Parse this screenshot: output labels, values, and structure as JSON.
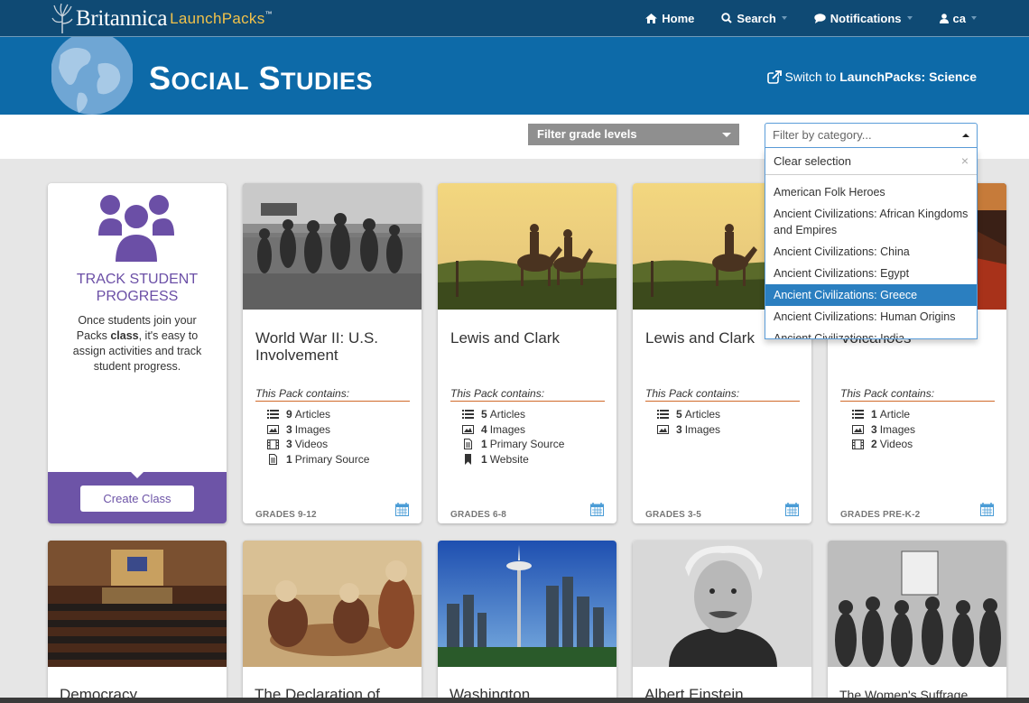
{
  "nav": {
    "logo_brand": "Britannica",
    "logo_product": "LaunchPacks",
    "logo_tm": "™",
    "home": "Home",
    "search": "Search",
    "notifications": "Notifications",
    "user": "ca"
  },
  "banner": {
    "title_first": "S",
    "title_first_rest": "OCIAL",
    "title_second": "S",
    "title_second_rest": "TUDIES",
    "switch_prefix": "Switch to ",
    "switch_target": "LaunchPacks: Science"
  },
  "filters": {
    "grade_placeholder": "Filter grade levels",
    "category_placeholder": "Filter by category..."
  },
  "dropdown": {
    "clear": "Clear selection",
    "options": [
      "American Folk Heroes",
      "Ancient Civilizations: African Kingdoms and Empires",
      "Ancient Civilizations: China",
      "Ancient Civilizations: Egypt",
      "Ancient Civilizations: Greece",
      "Ancient Civilizations: Human Origins",
      "Ancient Civilizations: India"
    ],
    "selected_index": 4
  },
  "track": {
    "title_line1": "TRACK STUDENT",
    "title_line2": "PROGRESS",
    "desc_pre": "Once students join your Packs ",
    "desc_bold": "class",
    "desc_post": ", it's easy to assign activities and track student progress.",
    "button": "Create Class"
  },
  "contains_label": "This Pack contains:",
  "cards": [
    {
      "title": "World War II: U.S. Involvement",
      "items": [
        {
          "icon": "list-icon",
          "count": "9",
          "label": "Articles"
        },
        {
          "icon": "image-icon",
          "count": "3",
          "label": "Images"
        },
        {
          "icon": "film-icon",
          "count": "3",
          "label": "Videos"
        },
        {
          "icon": "document-icon",
          "count": "1",
          "label": "Primary Source"
        }
      ],
      "grades": "GRADES 9-12"
    },
    {
      "title": "Lewis and Clark",
      "items": [
        {
          "icon": "list-icon",
          "count": "5",
          "label": "Articles"
        },
        {
          "icon": "image-icon",
          "count": "4",
          "label": "Images"
        },
        {
          "icon": "document-icon",
          "count": "1",
          "label": "Primary Source"
        },
        {
          "icon": "bookmark-icon",
          "count": "1",
          "label": "Website"
        }
      ],
      "grades": "GRADES 6-8"
    },
    {
      "title": "Lewis and Clark",
      "items": [
        {
          "icon": "list-icon",
          "count": "5",
          "label": "Articles"
        },
        {
          "icon": "image-icon",
          "count": "3",
          "label": "Images"
        }
      ],
      "grades": "GRADES 3-5"
    },
    {
      "title": "Volcanoes",
      "items": [
        {
          "icon": "list-icon",
          "count": "1",
          "label": "Article"
        },
        {
          "icon": "image-icon",
          "count": "3",
          "label": "Images"
        },
        {
          "icon": "film-icon",
          "count": "2",
          "label": "Videos"
        }
      ],
      "grades": "GRADES PRE-K-2"
    }
  ],
  "bottom_cards": [
    "Democracy",
    "The Declaration of",
    "Washington",
    "Albert Einstein",
    "The Women's Suffrage"
  ]
}
